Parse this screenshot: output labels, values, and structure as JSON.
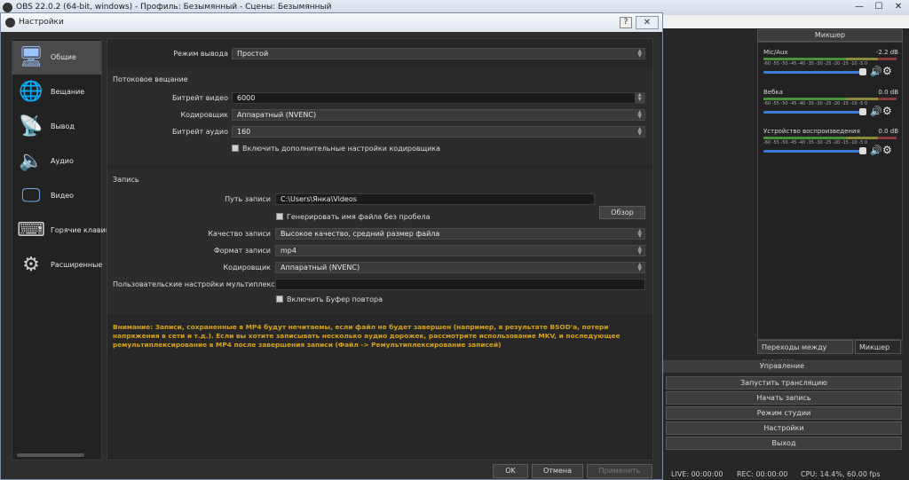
{
  "app": {
    "title": "OBS 22.0.2 (64-bit, windows) - Профиль: Безымянный - Сцены: Безымянный"
  },
  "window_controls": {
    "minimize": "—",
    "maximize": "☐",
    "close": "✕"
  },
  "mixer": {
    "title": "Микшер",
    "channels": [
      {
        "name": "Mic/Aux",
        "db": "-2.2 dB",
        "ticks": "-60 -55 -50 -45 -40 -35 -30 -25 -20 -15 -10 -5 0"
      },
      {
        "name": "Вебка",
        "db": "0.0 dB",
        "ticks": "-60 -55 -50 -45 -40 -35 -30 -25 -20 -15 -10 -5 0"
      },
      {
        "name": "Устройство воспроизведения",
        "db": "0.0 dB",
        "ticks": "-60 -55 -50 -45 -40 -35 -30 -25 -20 -15 -10 -5 0"
      }
    ],
    "volume_icon": "speaker-icon",
    "gear_icon": "gear-icon"
  },
  "dock_tabs": {
    "transitions": "Переходы между сценами",
    "mixer": "Микшер"
  },
  "controls": {
    "title": "Управление",
    "buttons": [
      "Запустить трансляцию",
      "Начать запись",
      "Режим студии",
      "Настройки",
      "Выход"
    ]
  },
  "status": {
    "live": "LIVE: 00:00:00",
    "rec": "REC: 00:00:00",
    "cpu": "CPU: 14.4%, 60.00 fps"
  },
  "dialog": {
    "title": "Настройки",
    "help": "?",
    "close": "✕",
    "sidebar": [
      {
        "label": "Общие",
        "icon": "computer-icon"
      },
      {
        "label": "Вещание",
        "icon": "globe-icon"
      },
      {
        "label": "Вывод",
        "icon": "antenna-icon"
      },
      {
        "label": "Аудио",
        "icon": "speaker-icon"
      },
      {
        "label": "Видео",
        "icon": "monitor-icon"
      },
      {
        "label": "Горячие клавиши",
        "icon": "keyboard-icon"
      },
      {
        "label": "Расширенные",
        "icon": "gears-icon"
      }
    ],
    "output_mode": {
      "label": "Режим вывода",
      "value": "Простой"
    },
    "streaming": {
      "heading": "Потоковое вещание",
      "video_bitrate": {
        "label": "Битрейт видео",
        "value": "6000"
      },
      "encoder": {
        "label": "Кодировщик",
        "value": "Аппаратный (NVENC)"
      },
      "audio_bitrate": {
        "label": "Битрейт аудио",
        "value": "160"
      },
      "advanced_checkbox": "Включить дополнительные настройки кодировщика"
    },
    "recording": {
      "heading": "Запись",
      "path": {
        "label": "Путь записи",
        "value": "C:\\Users\\Янка\\Videos"
      },
      "browse": "Обзор",
      "no_space_checkbox": "Генерировать имя файла без пробела",
      "quality": {
        "label": "Качество записи",
        "value": "Высокое качество, средний размер файла"
      },
      "format": {
        "label": "Формат записи",
        "value": "mp4"
      },
      "encoder": {
        "label": "Кодировщик",
        "value": "Аппаратный (NVENC)"
      },
      "muxer": {
        "label": "Пользовательские настройки мультиплексора",
        "value": ""
      },
      "replay_buffer_checkbox": "Включить Буфер повтора"
    },
    "warning": "Внимание: Записи, сохраненные в MP4 будут нечитаемы, если файл не будет завершен (например, в результате BSOD'а, потери напряжения в сети и т.д.). Если вы хотите записывать несколько аудио дорожек, рассмотрите использование MKV, и последующее ремультиплексирование в MP4 после завершения записи (Файл -> Ремультиплексирование записей)",
    "buttons": {
      "ok": "OK",
      "cancel": "Отмена",
      "apply": "Применить"
    },
    "colors": {
      "warning": "#d4a21a",
      "active_item": "#4a4a4a",
      "slider": "#3a7bd5"
    }
  }
}
